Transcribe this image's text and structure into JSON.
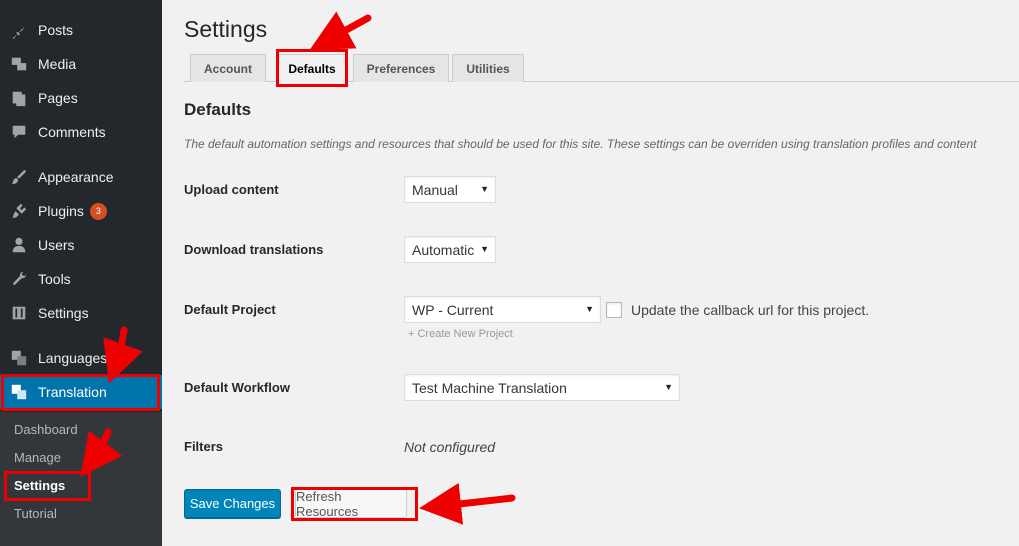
{
  "sidebar": {
    "items": [
      {
        "label": "Posts",
        "icon": "pushpin-icon"
      },
      {
        "label": "Media",
        "icon": "media-icon"
      },
      {
        "label": "Pages",
        "icon": "pages-icon"
      },
      {
        "label": "Comments",
        "icon": "comment-icon"
      },
      {
        "label": "Appearance",
        "icon": "paintbrush-icon"
      },
      {
        "label": "Plugins",
        "icon": "plugin-icon",
        "badge": "3"
      },
      {
        "label": "Users",
        "icon": "user-icon"
      },
      {
        "label": "Tools",
        "icon": "wrench-icon"
      },
      {
        "label": "Settings",
        "icon": "settings-icon"
      },
      {
        "label": "Languages",
        "icon": "translate-icon"
      },
      {
        "label": "Translation",
        "icon": "translate-icon"
      }
    ],
    "submenu": [
      "Dashboard",
      "Manage",
      "Settings",
      "Tutorial"
    ]
  },
  "page": {
    "title": "Settings",
    "tabs": [
      "Account",
      "Defaults",
      "Preferences",
      "Utilities"
    ],
    "active_tab": "Defaults",
    "section_title": "Defaults",
    "description": "The default automation settings and resources that should be used for this site. These settings can be overriden using translation profiles and content"
  },
  "form": {
    "upload": {
      "label": "Upload content",
      "value": "Manual"
    },
    "download": {
      "label": "Download translations",
      "value": "Automatic"
    },
    "project": {
      "label": "Default Project",
      "value": "WP - Current",
      "checkbox_label": "Update the callback url for this project.",
      "create_link": "+ Create New Project"
    },
    "workflow": {
      "label": "Default Workflow",
      "value": "Test Machine Translation"
    },
    "filters": {
      "label": "Filters",
      "value": "Not configured"
    }
  },
  "buttons": {
    "save": "Save Changes",
    "refresh": "Refresh Resources"
  },
  "colors": {
    "sidebar_bg": "#23282d",
    "accent": "#0073aa",
    "annotation": "#e00000"
  }
}
